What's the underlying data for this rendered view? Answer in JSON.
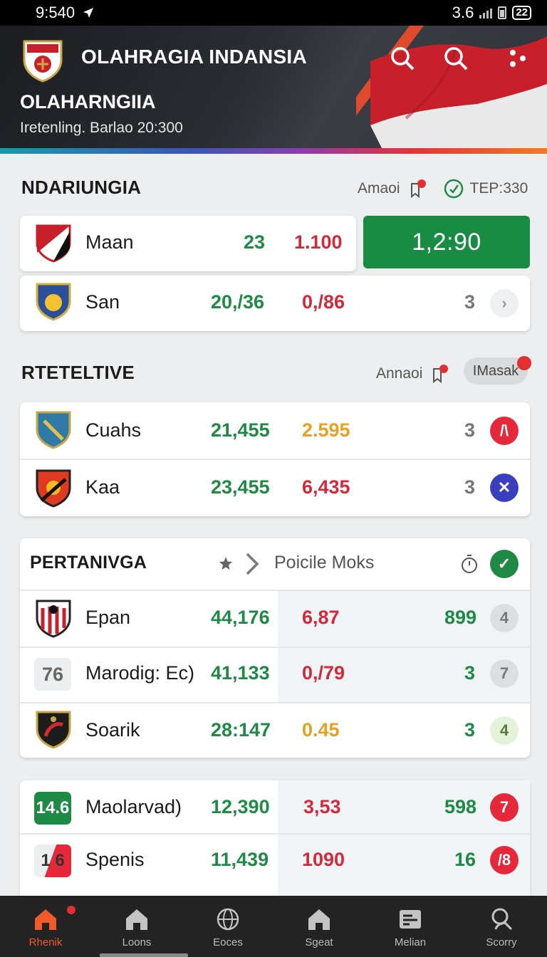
{
  "status_bar": {
    "time": "9:540",
    "network": "3.6",
    "battery_label": "22"
  },
  "header": {
    "title": "OLAHRAGIA INDANSIA",
    "subtitle": "OLAHARNGIIA",
    "meta": "Iretenling. Barlao 20:300",
    "icons": [
      "search-icon",
      "search-icon",
      "more-icon"
    ]
  },
  "section1": {
    "title": "NDARIUNGIA",
    "right_label": "Amaoi",
    "right_extra": "TEP:330",
    "action_button": "1,2:90",
    "rows": [
      {
        "name": "Maan",
        "v1": "23",
        "v2": "1.100"
      },
      {
        "name": "San",
        "v1": "20,/36",
        "v2": "0,/86",
        "count": "3"
      }
    ]
  },
  "section2": {
    "title": "RTETELTIVE",
    "right_label": "Annaoi",
    "chip_label": "IMasak",
    "rows": [
      {
        "name": "Cuahs",
        "v1": "21,455",
        "v2": "2.595",
        "count": "3",
        "badge": "/\\",
        "badge_color": "#e5283a"
      },
      {
        "name": "Kaa",
        "v1": "23,455",
        "v2": "6,435",
        "count": "3",
        "badge": "✕",
        "badge_color": "#3a3fc0"
      }
    ]
  },
  "section3": {
    "title": "PERTANIVGA",
    "filter_label": "Poicile Moks",
    "rows": [
      {
        "name": "Epan",
        "v1": "44,176",
        "v2": "6,87",
        "count": "899",
        "badge": "4"
      },
      {
        "tag": "76",
        "name": "Marodig: Ec)",
        "v1": "41,133",
        "v2": "0,/79",
        "count": "3",
        "badge": "7"
      },
      {
        "name": "Soarik",
        "v1": "28:147",
        "v2": "0.45",
        "count": "3",
        "badge": "4"
      }
    ]
  },
  "section4": {
    "rows": [
      {
        "tag": "14.6",
        "name": "Maolarvad)",
        "v1": "12,390",
        "v2": "3,53",
        "count": "598",
        "badge": "7"
      },
      {
        "tag": "1 6",
        "name": "Spenis",
        "v1": "11,439",
        "v2": "1090",
        "count": "16",
        "badge": "/8"
      }
    ]
  },
  "bottom_nav": [
    {
      "label": "Rhenik",
      "icon": "home-icon",
      "active": true
    },
    {
      "label": "Loons",
      "icon": "home-icon"
    },
    {
      "label": "Eoces",
      "icon": "globe-icon"
    },
    {
      "label": "Sgeat",
      "icon": "home-icon"
    },
    {
      "label": "Melian",
      "icon": "list-icon"
    },
    {
      "label": "Scorry",
      "icon": "search-icon"
    }
  ],
  "colors": {
    "green": "#1e8a45",
    "red": "#d22a3a",
    "orange": "#e8a020",
    "accent": "#f05a28"
  }
}
